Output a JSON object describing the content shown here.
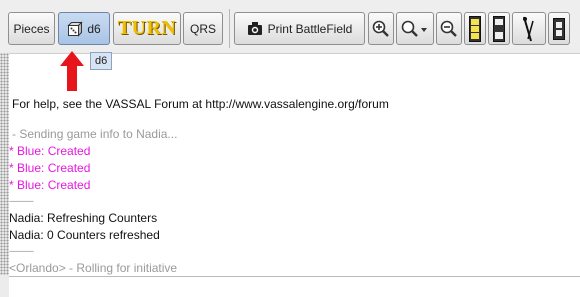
{
  "toolbar": {
    "pieces_label": "Pieces",
    "d6_label": "d6",
    "turn_label": "TURN",
    "qrs_label": "QRS",
    "print_label": "Print BattleField",
    "zoom_in_icon": "zoom-in-icon",
    "zoom_menu_icon": "zoom-dropdown-icon",
    "zoom_out_icon": "zoom-out-icon",
    "los_icon": "los-counter-icon",
    "ow_icon": "opportunity-fire-counter-icon",
    "figure_icon": "soldier-figure-icon",
    "misc_icon": "counter-icon"
  },
  "tooltip": {
    "text": "d6"
  },
  "annotation": {
    "color": "#e8141b"
  },
  "chat": {
    "lines": [
      {
        "text": "For help, see the VASSAL Forum at http://www.vassalengine.org/forum",
        "style": "black"
      },
      {
        "text": "- Sending game info to Nadia...",
        "style": "grey"
      },
      {
        "text": "* Blue: Created",
        "style": "mag"
      },
      {
        "text": "* Blue: Created",
        "style": "mag"
      },
      {
        "text": "* Blue: Created",
        "style": "mag"
      },
      {
        "text": "------------",
        "style": "dash"
      },
      {
        "text": "Nadia: Refreshing Counters",
        "style": "black"
      },
      {
        "text": "Nadia: 0 Counters refreshed",
        "style": "black"
      },
      {
        "text": "------------",
        "style": "dash"
      },
      {
        "text": "<Orlando> - Rolling for initiative",
        "style": "grey"
      }
    ]
  },
  "colors": {
    "magenta": "#e817e0",
    "turn_gold": "#f1bf00"
  }
}
